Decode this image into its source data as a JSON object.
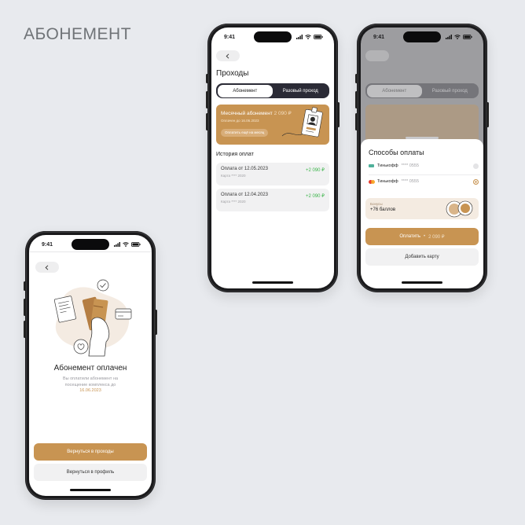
{
  "page_title": "АБОНЕМЕНТ",
  "status_time": "9:41",
  "colors": {
    "accent": "#c89452",
    "dark": "#2b2b36",
    "success": "#3bb54a",
    "background": "#e8eaee"
  },
  "success_screen": {
    "title": "Абонемент оплачен",
    "subtitle_line1": "Вы оплатили абонемент на",
    "subtitle_line2": "посещение комплекса до",
    "date": "16.06.2023",
    "primary_button": "Вернуться в проходы",
    "secondary_button": "Вернуться в профиль"
  },
  "passes_screen": {
    "title": "Проходы",
    "tabs": [
      {
        "label": "Абонемент",
        "active": true
      },
      {
        "label": "Разовый проход",
        "active": false
      }
    ],
    "subscription_card": {
      "title": "Месячный абонемент",
      "price": "2 090 ₽",
      "paid_until": "Оплачен до 16.06.2023",
      "button": "Оплатить ещё на месяц"
    },
    "history_title": "История оплат",
    "payments": [
      {
        "title": "Оплата от 12.05.2023",
        "card": "Карта **** 2020",
        "amount": "+2 090 ₽"
      },
      {
        "title": "Оплата от 12.04.2023",
        "card": "Карта **** 2020",
        "amount": "+2 090 ₽"
      }
    ]
  },
  "payment_methods_screen": {
    "title": "Способы оплаты",
    "methods": [
      {
        "bank": "Тинькофф",
        "masked": "**** 0555",
        "selected": false
      },
      {
        "bank": "Тинькофф",
        "masked": "**** 0555",
        "selected": true
      }
    ],
    "bonus_label": "Бонусы",
    "bonus_value": "+76 баллов",
    "pay_button": "Оплатить",
    "pay_amount": "2 090 ₽",
    "add_card_button": "Добавить карту",
    "bg_tabs": [
      "Абонемент",
      "Разовый проход"
    ]
  },
  "icons": [
    "back-chevron-icon",
    "signal-icon",
    "wifi-icon",
    "battery-icon",
    "badge-icon",
    "card-icon",
    "coins-icon",
    "heart-icon",
    "check-icon"
  ]
}
